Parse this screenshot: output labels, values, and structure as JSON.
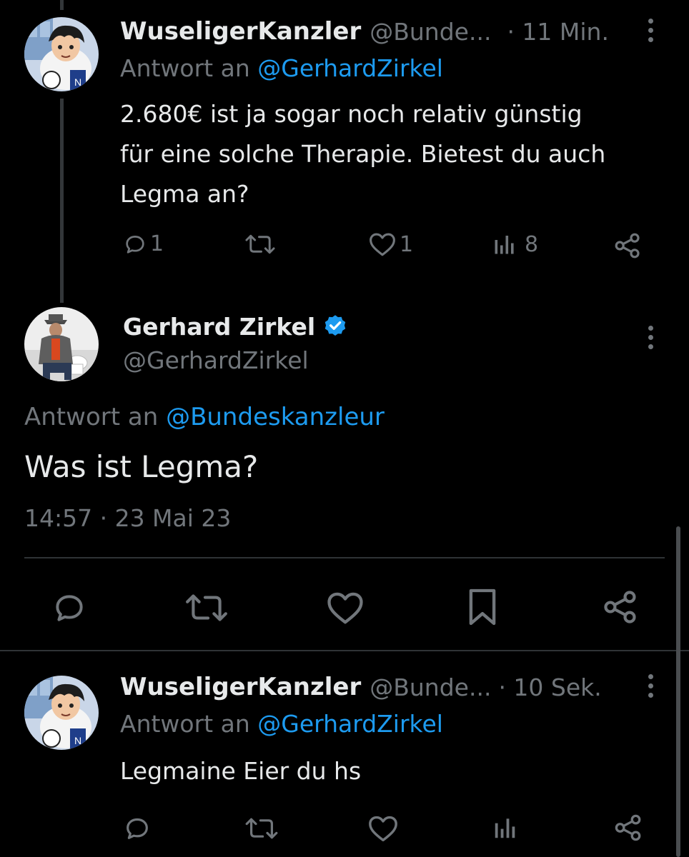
{
  "tweet1": {
    "display_name": "WuseligerKanzler",
    "handle": "@Bunde...",
    "time": "· 11 Min.",
    "reply_prefix": "Antwort an",
    "reply_to": "@GerhardZirkel",
    "lines": [
      "2.680€ ist ja sogar noch relativ günstig",
      "für eine solche Therapie. Bietest du auch",
      "Legma an?"
    ],
    "actions": {
      "reply_count": "1",
      "like_count": "1",
      "views_count": "8"
    }
  },
  "main_tweet": {
    "display_name": "Gerhard Zirkel",
    "handle": "@GerhardZirkel",
    "reply_prefix": "Antwort an",
    "reply_to": "@Bundeskanzleur",
    "text": "Was ist Legma?",
    "timestamp": "14:57 · 23 Mai 23"
  },
  "tweet3": {
    "display_name": "WuseligerKanzler",
    "handle": "@Bunde...",
    "time": "· 10 Sek.",
    "reply_prefix": "Antwort an",
    "reply_to": "@GerhardZirkel",
    "text": "Legmaine Eier du hs"
  },
  "colors": {
    "background": "#000000",
    "text": "#e7e9ea",
    "muted": "#71767b",
    "link": "#1d9bf0",
    "verified": "#1d9bf0",
    "divider": "#2f3336"
  },
  "icons": [
    "reply-icon",
    "retweet-icon",
    "like-icon",
    "views-icon",
    "share-icon",
    "bookmark-icon",
    "verified-badge-icon",
    "more-options-icon"
  ]
}
